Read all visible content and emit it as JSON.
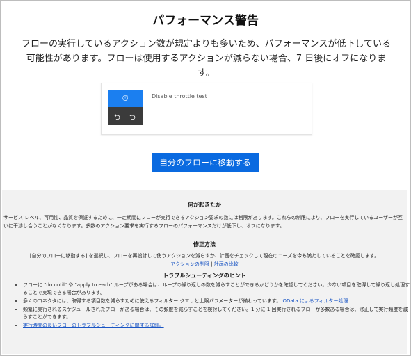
{
  "page": {
    "title": "パフォーマンス警告",
    "lead": "フローの実行しているアクション数が規定よりも多いため、パフォーマンスが低下している可能性があります。フローは使用するアクションが減らない場合、7 日後にオフになります。"
  },
  "flow_card": {
    "name": "Disable throttle test",
    "trigger_icon": "alarm-clock-icon",
    "step_icons": [
      "loop-icon",
      "loop-icon"
    ]
  },
  "actions": {
    "go_to_flow_label": "自分のフローに移動する"
  },
  "what_happened": {
    "heading": "何が起きたか",
    "body": "サービス レベル、可用性、品質を保証するために、一定期間にフローが実行できるアクション要求の数には制限があります。これらの制限により、フローを実行しているユーザーが互いに干渉し合うことがなくなります。多数のアクション要求を実行するフローのパフォーマンスだけが低下し、オフになります。"
  },
  "how_to_fix": {
    "heading": "修正方法",
    "body": "[自分のフローに移動する] を選択し、フローを再設計して使うアクションを減らすか、計画をチェックして現在のニーズを今も満たしていることを確認します。",
    "link_limits": "アクションの制限",
    "separator": "|",
    "link_plans": "計画の比較"
  },
  "troubleshooting": {
    "heading": "トラブルシューティングのヒント",
    "tips": [
      "フローに \"do until\" や \"apply to each\" ループがある場合は、ループの繰り返しの数を減らすことができるかどうかを確認してください。少ない項目を取得して繰り返し処理することで実現できる場合があります。",
      "多くのコネクタには、取得する項目数を減らすために使えるフィルター クエリと上限パラメーターが備わっています。",
      "頻繁に実行されるスケジュールされたフローがある場合は、その頻度を減らすことを検討してください。1 分に 1 回実行されるフローが多数ある場合は、修正して実行頻度を減らすことができます。"
    ],
    "tip2_link": "OData によるフィルター処理",
    "more_link": "実行時間の長いフローのトラブルシューティングに関する詳細。"
  }
}
